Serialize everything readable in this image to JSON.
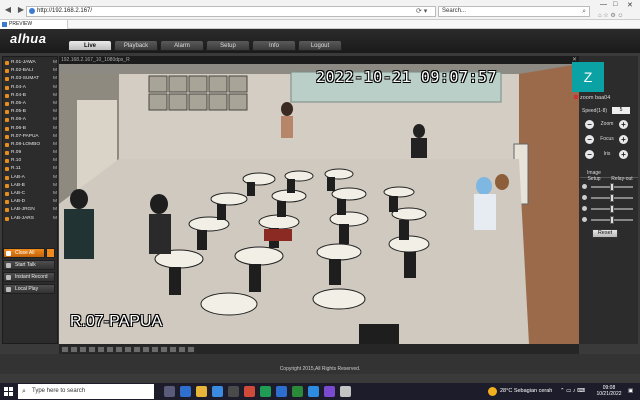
{
  "browser": {
    "address": "http://192.168.2.167/",
    "search_placeholder": "Search...",
    "tab_title": "PREVIEW",
    "window_controls": [
      "—",
      "□",
      "✕"
    ]
  },
  "app": {
    "logo": "alhua",
    "menu": [
      {
        "label": "Live",
        "active": true
      },
      {
        "label": "Playback",
        "active": false
      },
      {
        "label": "Alarm",
        "active": false
      },
      {
        "label": "Setup",
        "active": false
      },
      {
        "label": "Info",
        "active": false
      },
      {
        "label": "Logout",
        "active": false
      }
    ],
    "copyright": "Copyright 2015,All Rights Reserved."
  },
  "cameras": [
    "R.01-JAWA",
    "R.02-BALI",
    "R.03-SUMAT",
    "R.04-A",
    "R.04-B",
    "R.05-A",
    "R.05-B",
    "R.06-A",
    "R.06-B",
    "R.07-PAPUA",
    "R.08-LOMBO",
    "R.09",
    "R.10",
    "R.11",
    "LAB-A",
    "LAB-B",
    "LAB-C",
    "LAB-D",
    "LAB-JRGN",
    "LAB-JARS"
  ],
  "camera_flag": "M",
  "controls": {
    "close_all": "Close All",
    "start_talk": "Start Talk",
    "instant_record": "Instant Record",
    "local_play": "Local Play"
  },
  "video": {
    "title": "192.168.2.167_10_1080dps_R",
    "timestamp": "2022-10-21  09:07:57",
    "channel_name": "R.07-PAPUA"
  },
  "overlay": {
    "avatar_letter": "Z",
    "zoom_label": "zoom baa04"
  },
  "ptz": {
    "speed_label": "Speed(1-8)",
    "speed_value": "5",
    "zoom": "Zoom",
    "focus": "Focus",
    "iris": "Iris",
    "plus": "+",
    "minus": "−"
  },
  "image_setup": {
    "tab1": "Image Setup",
    "tab2": "Relay-out",
    "levels": [
      0.5,
      0.5,
      0.5,
      0.5
    ],
    "reset": "Reset"
  },
  "taskbar": {
    "search": "Type here to search",
    "weather": "28°C  Sebagian cerah",
    "time": "09:08",
    "date": "10/21/2022"
  }
}
